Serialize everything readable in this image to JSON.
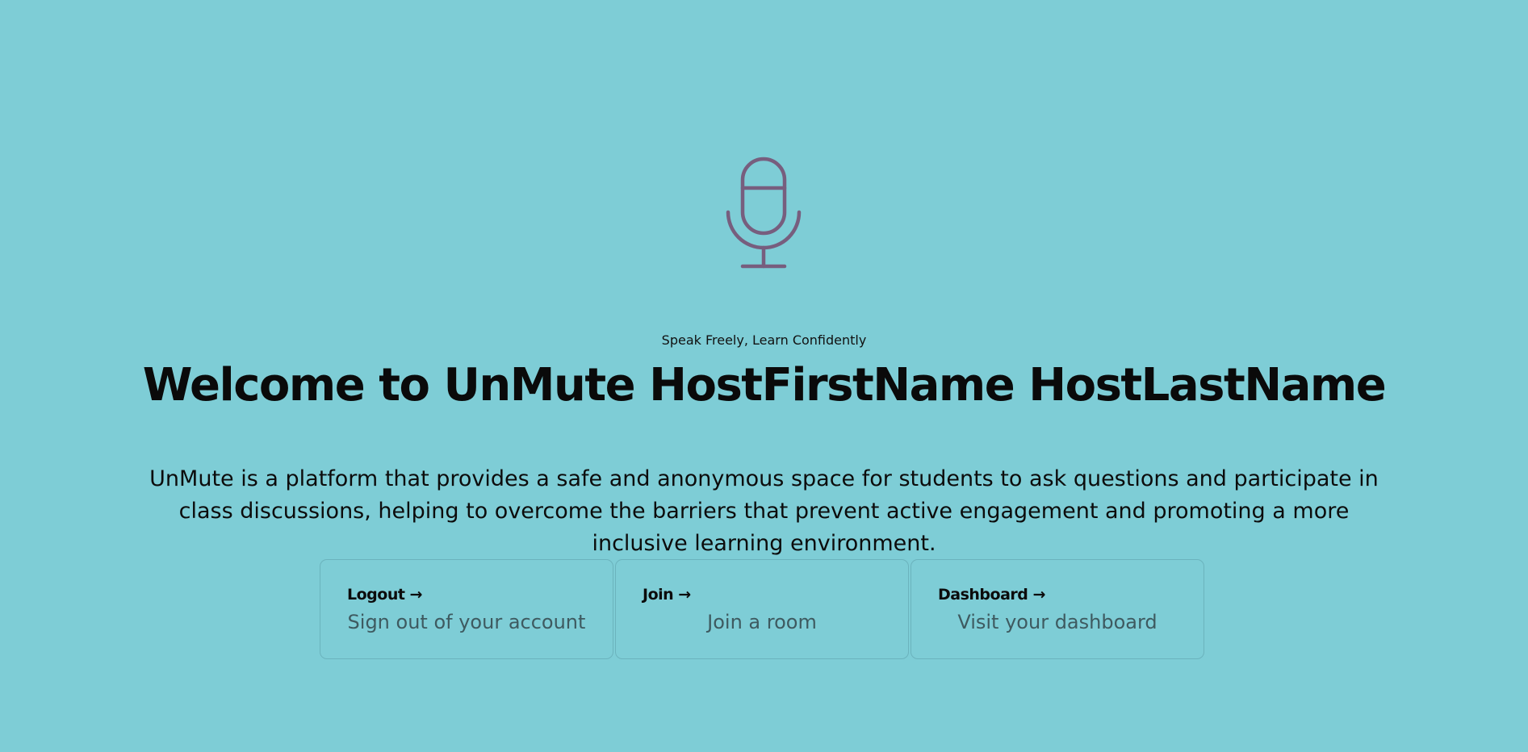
{
  "hero": {
    "icon": "microphone-icon",
    "icon_color": "#775e7e",
    "tagline": "Speak Freely, Learn Confidently",
    "title": "Welcome to UnMute HostFirstName HostLastName",
    "description": "UnMute is a platform that provides a safe and anonymous space for students to ask questions and participate in class discussions, helping to overcome the barriers that prevent active engagement and promoting a more inclusive learning environment."
  },
  "cards": [
    {
      "title": "Logout →",
      "description": "Sign out of your account"
    },
    {
      "title": "Join →",
      "description": "Join a room"
    },
    {
      "title": "Dashboard →",
      "description": "Visit your dashboard"
    }
  ],
  "colors": {
    "background": "#7ecdd6",
    "card_border": "#6bb3bd",
    "card_text": "#3e5a60"
  }
}
